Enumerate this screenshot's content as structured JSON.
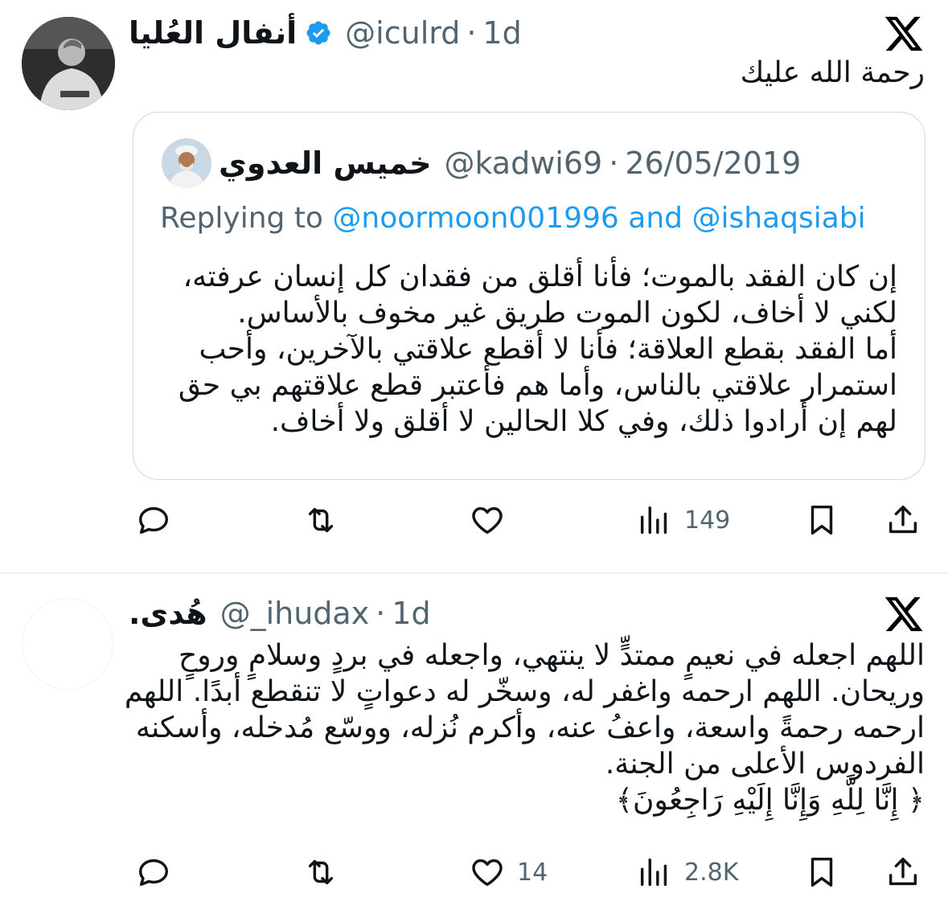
{
  "tweet1": {
    "name": "أنفال العُليا",
    "handle": "@iculrd",
    "sep": "·",
    "time": "1d",
    "text": "رحمة الله عليك",
    "quote": {
      "name": "خميس العدوي",
      "handle": "@kadwi69",
      "sep": "·",
      "date": "26/05/2019",
      "replying_prefix": "Replying to",
      "mention1": "@noormoon001996",
      "and": "and",
      "mention2": "@ishaqsiabi",
      "lines": [
        "إن كان الفقد بالموت؛ فأنا أقلق من فقدان كل إنسان عرفته،",
        "لكني لا أخاف، لكون الموت طريق غير مخوف بالأساس.",
        "أما الفقد بقطع العلاقة؛ فأنا لا أقطع علاقتي بالآخرين، وأحب",
        "استمرار علاقتي بالناس، وأما هم فأعتبر قطع علاقتهم بي حق",
        "لهم إن أرادوا ذلك، وفي كلا الحالين لا أقلق ولا أخاف."
      ]
    },
    "views": "149"
  },
  "tweet2": {
    "name": "هُدى.",
    "handle": "@_ihudax",
    "sep": "·",
    "time": "1d",
    "lines": [
      "اللهم اجعله في نعيمٍ ممتدٍّ لا ينتهي، واجعله في بردٍ وسلامٍ وروحٍ",
      "وريحان. اللهم ارحمه واغفر له، وسخّر له دعواتٍ لا تنقطع أبدًا. اللهم",
      "ارحمه رحمةً واسعة، واعفُ عنه، وأكرم نُزله، ووسّع مُدخله، وأسكنه",
      "الفردوس الأعلى من الجنة.",
      "﴿ إِنَّا لِلَّهِ وَإِنَّا إِلَيْهِ رَاجِعُونَ﴾"
    ],
    "likes": "14",
    "views": "2.8K"
  },
  "icons": {
    "logo": "x-logo-icon",
    "verified": "verified-badge-icon",
    "reply": "reply-icon",
    "repost": "repost-icon",
    "like": "heart-icon",
    "views": "views-icon",
    "bookmark": "bookmark-icon",
    "share": "share-icon"
  },
  "colors": {
    "accent": "#1d9bf0",
    "secondary_text": "#536471",
    "border": "#cfd9de"
  }
}
